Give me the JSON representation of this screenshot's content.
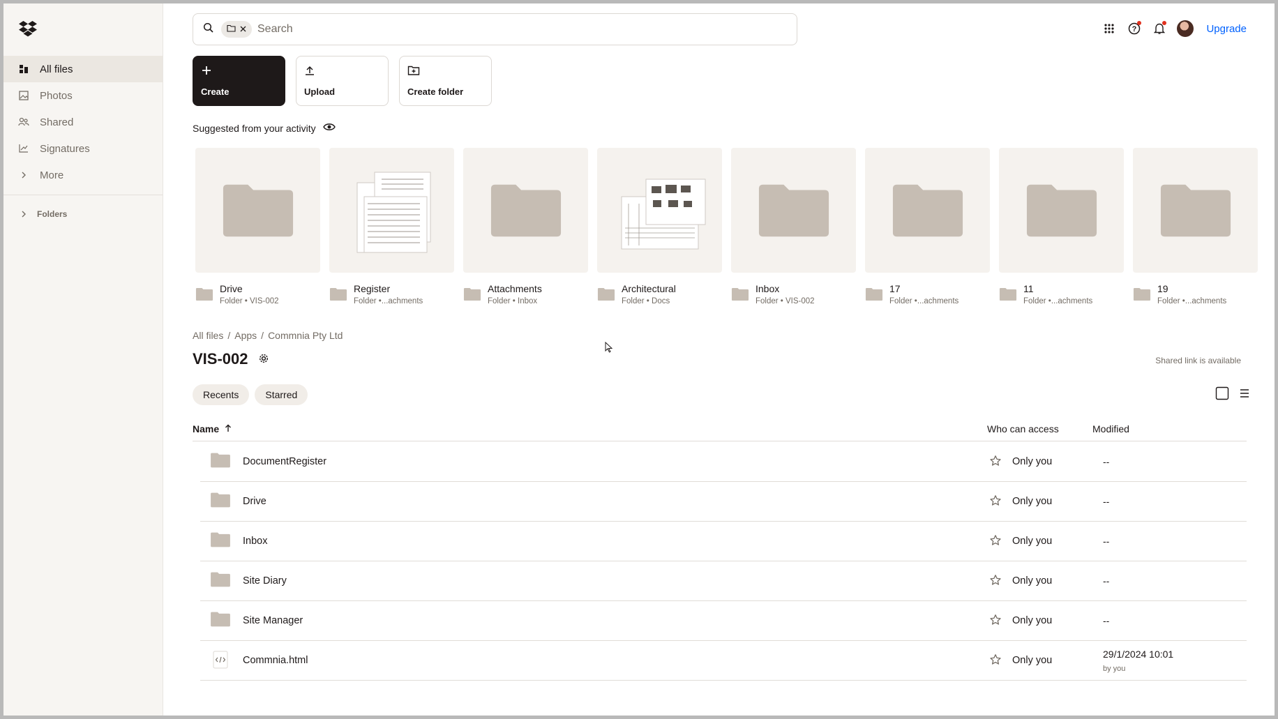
{
  "sidebar": {
    "items": [
      {
        "label": "All files",
        "icon": "all-files-icon",
        "active": true
      },
      {
        "label": "Photos",
        "icon": "photos-icon"
      },
      {
        "label": "Shared",
        "icon": "shared-icon"
      },
      {
        "label": "Signatures",
        "icon": "signatures-icon"
      },
      {
        "label": "More",
        "icon": "chevron-right-icon"
      }
    ],
    "folders_label": "Folders"
  },
  "search": {
    "placeholder": "Search",
    "value": ""
  },
  "header": {
    "upgrade_label": "Upgrade"
  },
  "actions": {
    "create_label": "Create",
    "upload_label": "Upload",
    "create_folder_label": "Create folder"
  },
  "suggested": {
    "title": "Suggested from your activity",
    "cards": [
      {
        "name": "Drive",
        "sub": "Folder • VIS-002",
        "thumb": "folder"
      },
      {
        "name": "Register",
        "sub": "Folder •...achments",
        "thumb": "document"
      },
      {
        "name": "Attachments",
        "sub": "Folder • Inbox",
        "thumb": "folder"
      },
      {
        "name": "Architectural",
        "sub": "Folder • Docs",
        "thumb": "drawing"
      },
      {
        "name": "Inbox",
        "sub": "Folder • VIS-002",
        "thumb": "folder"
      },
      {
        "name": "17",
        "sub": "Folder •...achments",
        "thumb": "folder"
      },
      {
        "name": "11",
        "sub": "Folder •...achments",
        "thumb": "folder"
      },
      {
        "name": "19",
        "sub": "Folder •...achments",
        "thumb": "folder"
      }
    ]
  },
  "breadcrumb": {
    "items": [
      "All files",
      "Apps",
      "Commnia Pty Ltd"
    ],
    "separator": "/"
  },
  "page": {
    "title": "VIS-002",
    "shared_link": "Shared link is available"
  },
  "filters": {
    "recents_label": "Recents",
    "starred_label": "Starred"
  },
  "table": {
    "headers": {
      "name": "Name",
      "access": "Who can access",
      "modified": "Modified"
    },
    "rows": [
      {
        "name": "DocumentRegister",
        "type": "folder",
        "access": "Only you",
        "modified": "--"
      },
      {
        "name": "Drive",
        "type": "folder",
        "access": "Only you",
        "modified": "--"
      },
      {
        "name": "Inbox",
        "type": "folder",
        "access": "Only you",
        "modified": "--"
      },
      {
        "name": "Site Diary",
        "type": "folder",
        "access": "Only you",
        "modified": "--"
      },
      {
        "name": "Site Manager",
        "type": "folder",
        "access": "Only you",
        "modified": "--"
      },
      {
        "name": "Commnia.html",
        "type": "html",
        "access": "Only you",
        "modified": "29/1/2024 10:01",
        "modified_by": "by you"
      }
    ]
  },
  "colors": {
    "accent": "#0061fe",
    "folder": "#c6bdb3",
    "primary_button": "#1e1919"
  }
}
